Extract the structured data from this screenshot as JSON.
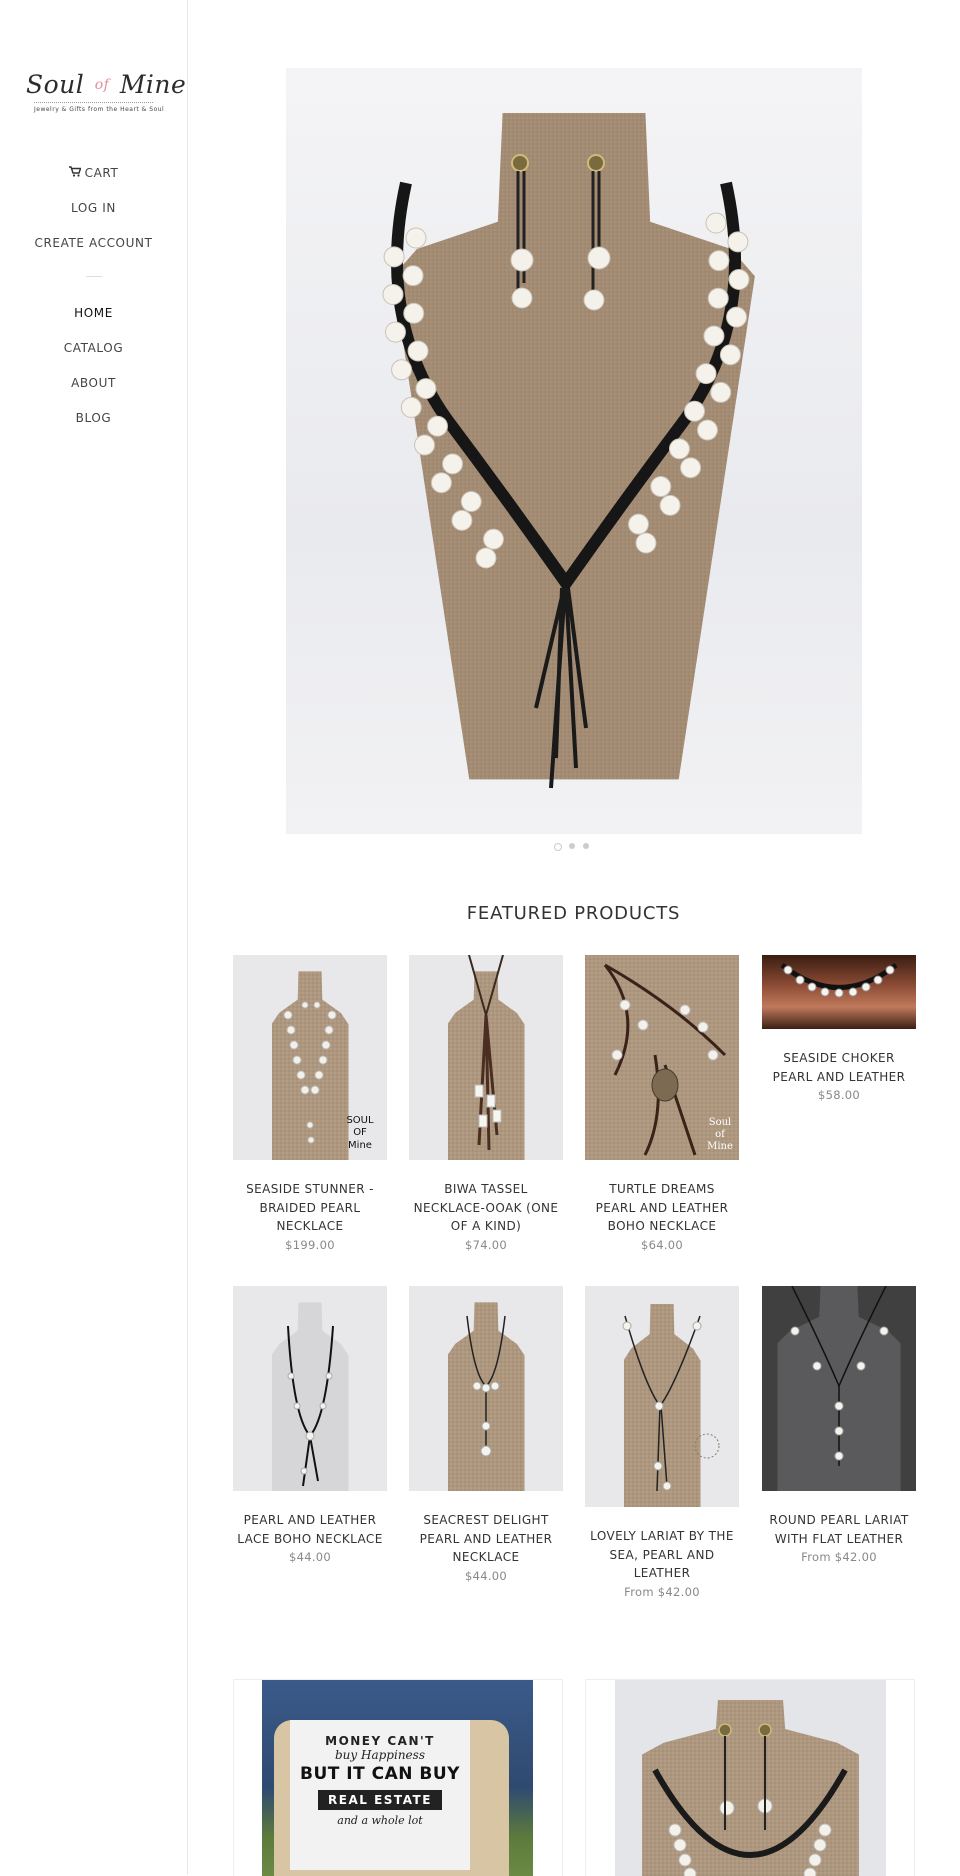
{
  "brand": {
    "logo_text_left": "Soul",
    "logo_text_of": "of",
    "logo_text_right": "Mine",
    "tagline": "Jewelry & Gifts from the Heart & Soul"
  },
  "account_nav": {
    "cart": "CART",
    "login": "LOG IN",
    "create_account": "CREATE ACCOUNT"
  },
  "main_nav": [
    {
      "label": "HOME",
      "active": true
    },
    {
      "label": "CATALOG",
      "active": false
    },
    {
      "label": "ABOUT",
      "active": false
    },
    {
      "label": "BLOG",
      "active": false
    }
  ],
  "slideshow": {
    "slides": 3,
    "current": 1
  },
  "featured": {
    "title": "FEATURED PRODUCTS",
    "products": [
      {
        "name": "SEASIDE STUNNER - BRAIDED PEARL NECKLACE",
        "price": "$199.00",
        "image": "pearl-braided-necklace"
      },
      {
        "name": "BIWA TASSEL NECKLACE-OOAK (ONE OF A KIND)",
        "price": "$74.00",
        "image": "biwa-tassel-necklace"
      },
      {
        "name": "TURTLE DREAMS PEARL AND LEATHER BOHO NECKLACE",
        "price": "$64.00",
        "image": "turtle-leather-necklace"
      },
      {
        "name": "SEASIDE CHOKER PEARL AND LEATHER",
        "price": "$58.00",
        "image": "pearl-choker"
      },
      {
        "name": "PEARL AND LEATHER LACE BOHO NECKLACE",
        "price": "$44.00",
        "image": "lace-boho-necklace"
      },
      {
        "name": "SEACREST DELIGHT PEARL AND LEATHER NECKLACE",
        "price": "$44.00",
        "image": "seacrest-necklace"
      },
      {
        "name": "LOVELY LARIAT BY THE SEA, PEARL AND LEATHER",
        "price": "From $42.00",
        "image": "lariat-necklace"
      },
      {
        "name": "ROUND PEARL LARIAT WITH FLAT LEATHER",
        "price": "From $42.00",
        "image": "round-pearl-lariat"
      }
    ]
  },
  "promo": {
    "pillow_lines": [
      "MONEY CAN'T",
      "buy Happiness",
      "BUT IT CAN BUY",
      "REAL ESTATE",
      "and a whole lot"
    ]
  }
}
